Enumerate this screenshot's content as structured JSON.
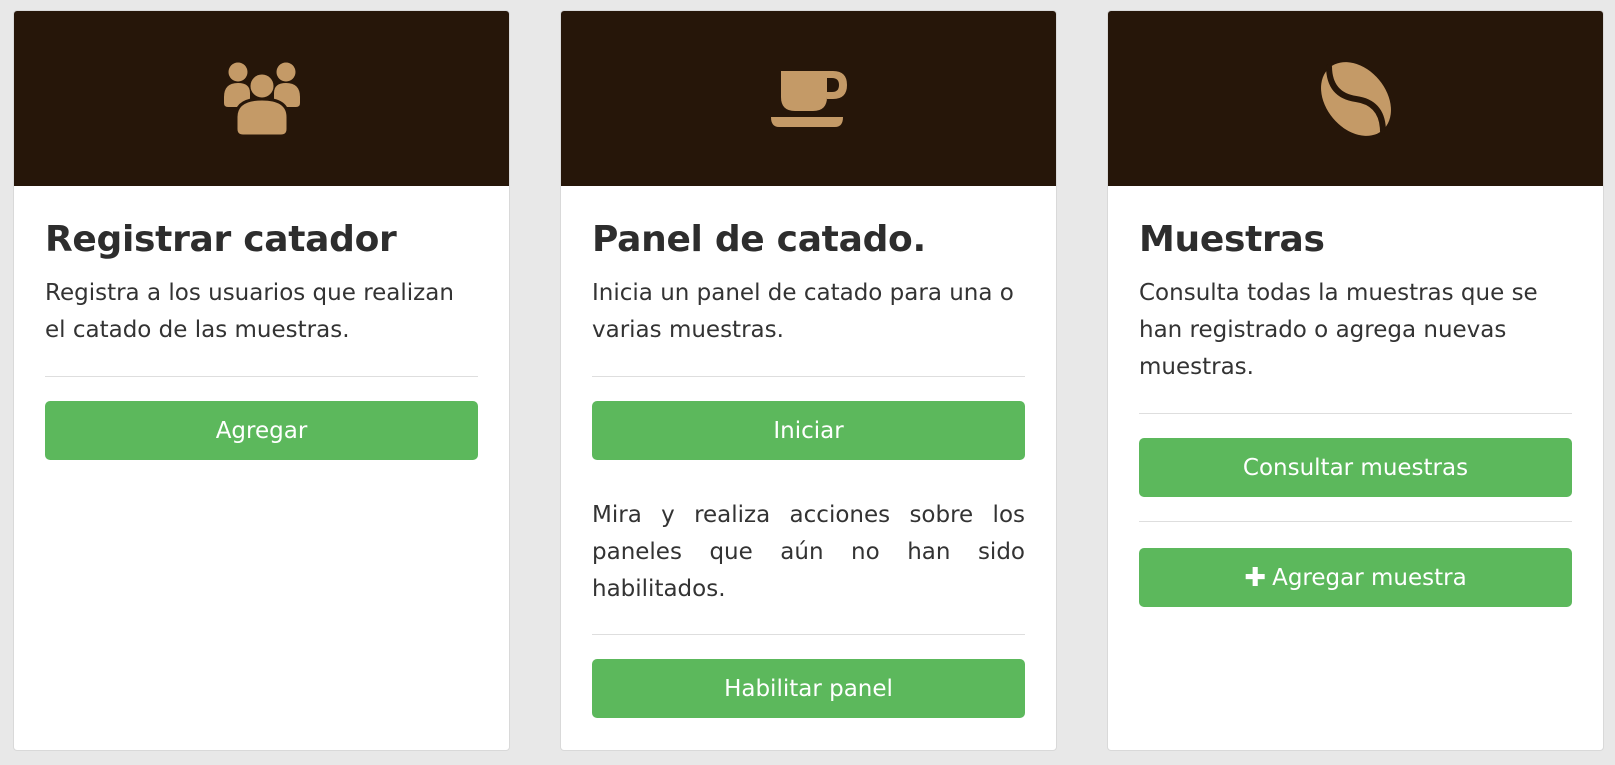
{
  "colors": {
    "header_bg": "#261609",
    "icon": "#c49a67",
    "button_bg": "#5cb85c",
    "page_bg": "#e8e8e8"
  },
  "cards": [
    {
      "icon": "users-icon",
      "title": "Registrar catador",
      "text": "Registra a los usuarios que realizan el catado de las muestras.",
      "buttons": [
        {
          "label": "Agregar"
        }
      ]
    },
    {
      "icon": "coffee-cup-icon",
      "title": "Panel de catado.",
      "text": "Inicia un panel de catado para una o varias muestras.",
      "buttons": [
        {
          "label": "Iniciar"
        }
      ],
      "extra_text": "Mira y realiza acciones sobre los paneles que aún no han sido habilitados.",
      "extra_buttons": [
        {
          "label": "Habilitar panel"
        }
      ]
    },
    {
      "icon": "coffee-bean-icon",
      "title": "Muestras",
      "text": "Consulta todas la muestras que se han registrado o agrega nuevas muestras.",
      "buttons": [
        {
          "label": "Consultar muestras"
        }
      ],
      "extra_buttons": [
        {
          "label": "Agregar muestra",
          "icon": "plus-icon"
        }
      ]
    }
  ]
}
